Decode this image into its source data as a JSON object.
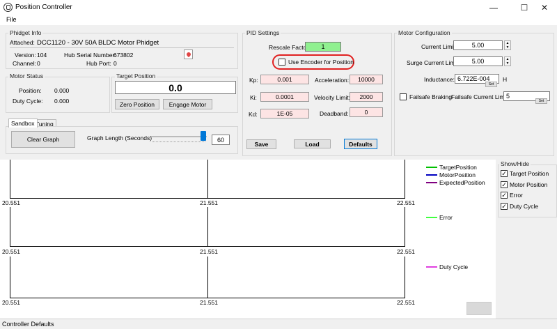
{
  "window": {
    "title": "Position Controller",
    "minimize": "—",
    "maximize": "☐",
    "close": "✕"
  },
  "menu": {
    "file": "File"
  },
  "phidget_info": {
    "legend": "Phidget Info",
    "attached_label": "Attached:",
    "attached_value": "DCC1120 - 30V 50A BLDC Motor Phidget",
    "version_label": "Version:",
    "version_value": "104",
    "channel_label": "Channel:",
    "channel_value": "0",
    "hub_serial_label": "Hub Serial Number:",
    "hub_serial_value": "673802",
    "hub_port_label": "Hub Port:",
    "hub_port_value": "0"
  },
  "motor_status": {
    "legend": "Motor Status",
    "position_label": "Position:",
    "position_value": "0.000",
    "duty_label": "Duty Cycle:",
    "duty_value": "0.000"
  },
  "target_position": {
    "legend": "Target Position",
    "value": "0.0",
    "zero_button": "Zero Position",
    "engage_button": "Engage Motor"
  },
  "tabs": {
    "sandbox": "Sandbox",
    "tuning": "Tuning"
  },
  "sandbox": {
    "clear_graph": "Clear Graph",
    "graph_length_label": "Graph Length (Seconds)",
    "graph_length_value": "60"
  },
  "pid": {
    "legend": "PID Settings",
    "rescale_label": "Rescale Factor:",
    "rescale_value": "1",
    "encoder_label": "Use Encoder for Position",
    "kp_label": "Kp:",
    "kp_value": "0.001",
    "ki_label": "Ki:",
    "ki_value": "0.0001",
    "kd_label": "Kd:",
    "kd_value": "1E-05",
    "accel_label": "Acceleration:",
    "accel_value": "10000",
    "velocity_label": "Velocity Limit:",
    "velocity_value": "2000",
    "deadband_label": "Deadband:",
    "deadband_value": "0",
    "save": "Save",
    "load": "Load",
    "defaults": "Defaults"
  },
  "motor_config": {
    "legend": "Motor Configuration",
    "current_limit_label": "Current Limit:",
    "current_limit_value": "5.00",
    "surge_limit_label": "Surge Current Limit:",
    "surge_limit_value": "5.00",
    "inductance_label": "Inductance:",
    "inductance_value": "6.722E-004",
    "inductance_unit": "H",
    "set_label": "Set",
    "failsafe_braking_label": "Failsafe Braking",
    "failsafe_current_label": "Failsafe Current Limit:",
    "failsafe_current_value": "5"
  },
  "show_hide": {
    "legend": "Show/Hide",
    "items": [
      {
        "label": "Target Position",
        "checked": true
      },
      {
        "label": "Motor Position",
        "checked": true
      },
      {
        "label": "Error",
        "checked": true
      },
      {
        "label": "Duty Cycle",
        "checked": true
      }
    ]
  },
  "chart_legend": {
    "target": "TargetPosition",
    "motor": "MotorPosition",
    "expected": "ExpectedPosition",
    "error": "Error",
    "duty": "Duty Cycle",
    "colors": {
      "target": "#00c000",
      "motor": "#0000c0",
      "expected": "#800080",
      "error": "#40ff40",
      "duty": "#e040e0"
    }
  },
  "status": {
    "text": "Controller Defaults"
  },
  "chart_data": [
    {
      "type": "line",
      "x_ticks": [
        "20.551",
        "21.551",
        "22.551"
      ],
      "series": []
    },
    {
      "type": "line",
      "x_ticks": [
        "20.551",
        "21.551",
        "22.551"
      ],
      "series": []
    },
    {
      "type": "line",
      "x_ticks": [
        "20.551",
        "21.551",
        "22.551"
      ],
      "series": []
    }
  ]
}
